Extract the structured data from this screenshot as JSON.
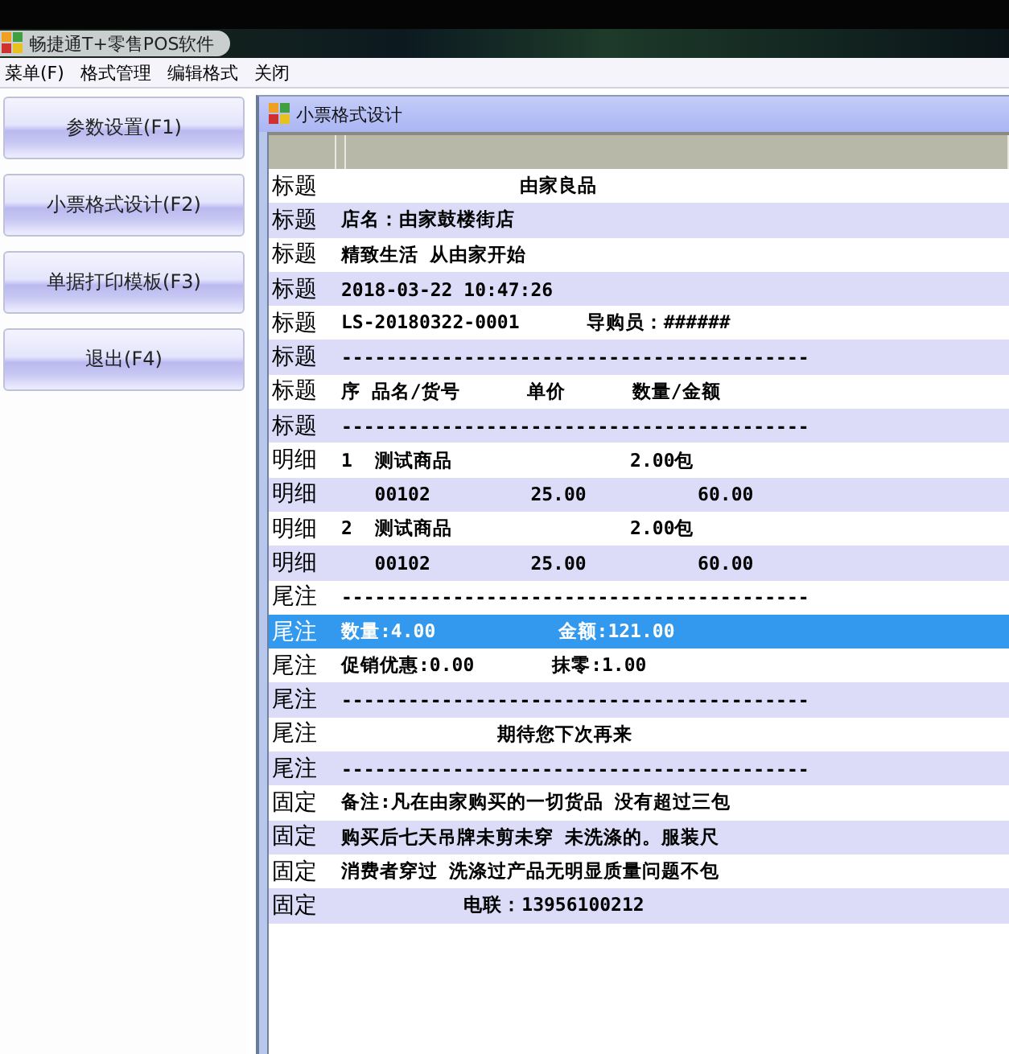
{
  "app_title": "畅捷通T+零售POS软件",
  "menu": [
    "菜单(F)",
    "格式管理",
    "编辑格式",
    "关闭"
  ],
  "side_buttons": [
    "参数设置(F1)",
    "小票格式设计(F2)",
    "单据打印模板(F3)",
    "退出(F4)"
  ],
  "window": {
    "title": "小票格式设计"
  },
  "rows": [
    {
      "label": "标题",
      "text": "                由家良品",
      "selected": false
    },
    {
      "label": "标题",
      "text": "店名：由家鼓楼街店",
      "selected": false
    },
    {
      "label": "标题",
      "text": "精致生活 从由家开始",
      "selected": false
    },
    {
      "label": "标题",
      "text": "2018-03-22 10:47:26",
      "selected": false
    },
    {
      "label": "标题",
      "text": "LS-20180322-0001      导购员：######",
      "selected": false
    },
    {
      "label": "标题",
      "text": "------------------------------------------",
      "selected": false
    },
    {
      "label": "标题",
      "text": "序 品名/货号      单价      数量/金额",
      "selected": false
    },
    {
      "label": "标题",
      "text": "------------------------------------------",
      "selected": false
    },
    {
      "label": "明细",
      "text": "1  测试商品                2.00包",
      "selected": false
    },
    {
      "label": "明细",
      "text": "   00102         25.00          60.00",
      "selected": false
    },
    {
      "label": "明细",
      "text": "2  测试商品                2.00包",
      "selected": false
    },
    {
      "label": "明细",
      "text": "   00102         25.00          60.00",
      "selected": false
    },
    {
      "label": "尾注",
      "text": "------------------------------------------",
      "selected": false
    },
    {
      "label": "尾注",
      "text": "数量:4.00           金额:121.00",
      "selected": true
    },
    {
      "label": "尾注",
      "text": "促销优惠:0.00       抹零:1.00",
      "selected": false
    },
    {
      "label": "尾注",
      "text": "------------------------------------------",
      "selected": false
    },
    {
      "label": "尾注",
      "text": "              期待您下次再来",
      "selected": false
    },
    {
      "label": "尾注",
      "text": "------------------------------------------",
      "selected": false
    },
    {
      "label": "固定",
      "text": "备注:凡在由家购买的一切货品 没有超过三包",
      "selected": false
    },
    {
      "label": "固定",
      "text": "购买后七天吊牌未剪未穿 未洗涤的。服装尺",
      "selected": false
    },
    {
      "label": "固定",
      "text": "消费者穿过 洗涤过产品无明显质量问题不包",
      "selected": false
    },
    {
      "label": "固定",
      "text": "           电联：13956100212",
      "selected": false
    }
  ]
}
